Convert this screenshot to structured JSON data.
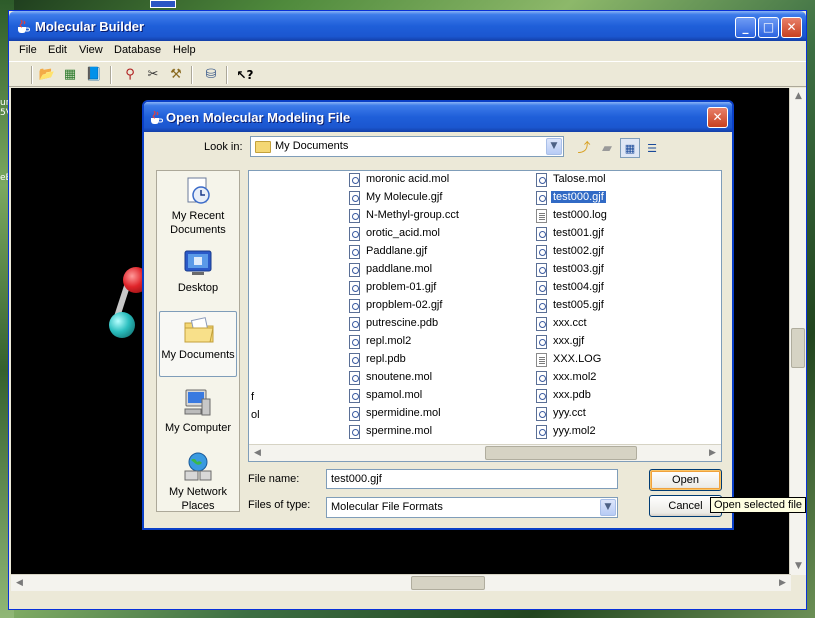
{
  "desktop": {
    "fragments": [
      "ur",
      "5V",
      "eB"
    ]
  },
  "app": {
    "title": "Molecular Builder",
    "window_buttons": {
      "minimize": "_",
      "maximize": "□",
      "close": "✕"
    },
    "menu": [
      "File",
      "Edit",
      "View",
      "Database",
      "Help"
    ]
  },
  "toolbar": {
    "buttons": [
      {
        "icon": "open-folder-icon",
        "glyph": "📂"
      },
      {
        "icon": "spreadsheet-icon",
        "glyph": "▦"
      },
      {
        "icon": "book-icon",
        "glyph": "📘"
      },
      {
        "icon": "bond-tool-icon",
        "glyph": "⚲"
      },
      {
        "icon": "cut-icon",
        "glyph": "✂"
      },
      {
        "icon": "hammer-icon",
        "glyph": "⚒"
      },
      {
        "icon": "database-icon",
        "glyph": "⛁"
      },
      {
        "icon": "whats-this-help-icon",
        "glyph": "↖?"
      }
    ]
  },
  "colors": {
    "titlebar_blue": "#1f5fd9",
    "selection": "#316ac5",
    "canvas": "#000000",
    "oxygen": "#e0242a",
    "nitrogen": "#2bbfbf"
  },
  "dialog": {
    "title": "Open Molecular Modeling File",
    "look_in_label": "Look in:",
    "look_in_value": "My Documents",
    "nav_icons": [
      "up-one-level-icon",
      "create-new-folder-icon",
      "list-view-icon",
      "details-view-icon"
    ],
    "places": [
      {
        "label": "My Recent Documents",
        "icon": "recent-documents-icon"
      },
      {
        "label": "Desktop",
        "icon": "desktop-icon"
      },
      {
        "label": "My Documents",
        "icon": "my-documents-icon",
        "selected": true
      },
      {
        "label": "My Computer",
        "icon": "my-computer-icon"
      },
      {
        "label": "My Network Places",
        "icon": "network-places-icon"
      }
    ],
    "list_fragments": [
      "f",
      "ol"
    ],
    "files_col1": [
      "moronic acid.mol",
      "My Molecule.gjf",
      "N-Methyl-group.cct",
      "orotic_acid.mol",
      "Paddlane.gjf",
      "paddlane.mol",
      "problem-01.gjf",
      "propblem-02.gjf",
      "putrescine.pdb",
      "repl.mol2",
      "repl.pdb",
      "snoutene.mol",
      "spamol.mol",
      "spermidine.mol",
      "spermine.mol"
    ],
    "files_col2": [
      "Talose.mol",
      "test000.gjf",
      "test000.log",
      "test001.gjf",
      "test002.gjf",
      "test003.gjf",
      "test004.gjf",
      "test005.gjf",
      "xxx.cct",
      "xxx.gjf",
      "XXX.LOG",
      "xxx.mol2",
      "xxx.pdb",
      "yyy.cct",
      "yyy.mol2"
    ],
    "selected_file": "test000.gjf",
    "file_name_label": "File name:",
    "file_name_value": "test000.gjf",
    "files_of_type_label": "Files of type:",
    "files_of_type_value": "Molecular File Formats",
    "open_button": "Open",
    "cancel_button": "Cancel",
    "tooltip": "Open selected file",
    "close": "✕"
  }
}
